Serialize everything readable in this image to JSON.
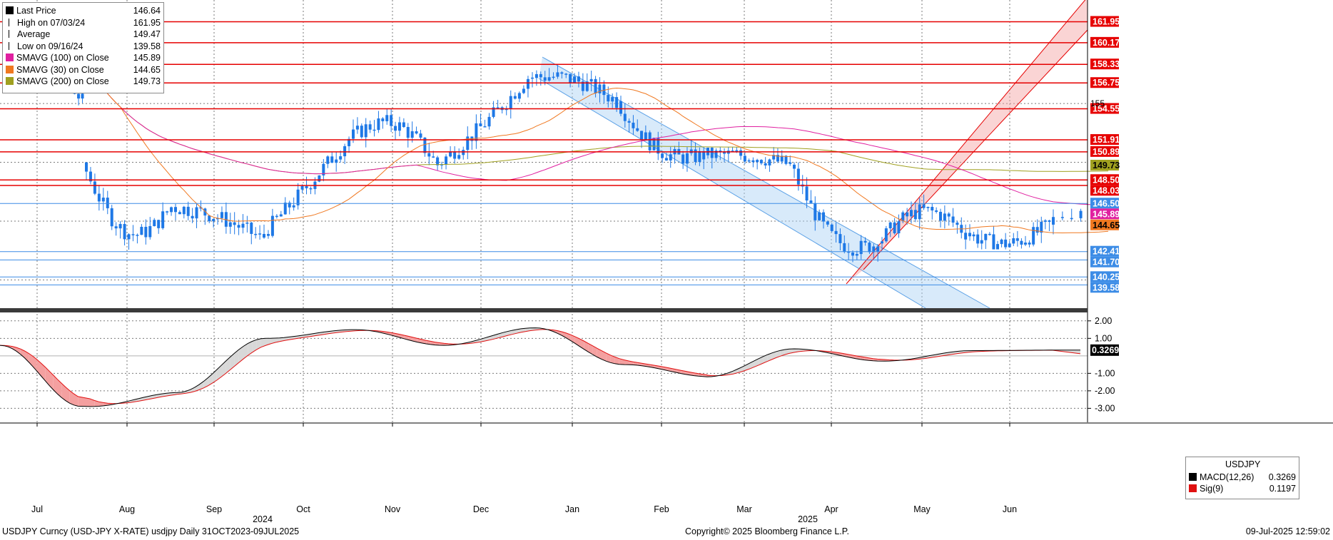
{
  "legend": {
    "rows": [
      {
        "label": "Last Price",
        "value": "146.64",
        "color": "#000000",
        "swatch": "square"
      },
      {
        "label": "High on 07/03/24",
        "value": "161.95",
        "color": "#000000",
        "swatch": "tick-high"
      },
      {
        "label": "Average",
        "value": "149.47",
        "color": "#000000",
        "swatch": "dash"
      },
      {
        "label": "Low on 09/16/24",
        "value": "139.58",
        "color": "#000000",
        "swatch": "tick-low"
      },
      {
        "label": "SMAVG (100)  on Close",
        "value": "145.89",
        "color": "#e020a0",
        "swatch": "square"
      },
      {
        "label": "SMAVG (30)  on Close",
        "value": "144.65",
        "color": "#f07820",
        "swatch": "square"
      },
      {
        "label": "SMAVG (200)  on Close",
        "value": "149.73",
        "color": "#a0a020",
        "swatch": "square"
      }
    ]
  },
  "macd_legend": {
    "title": "USDJPY",
    "rows": [
      {
        "label": "MACD(12,26)",
        "value": "0.3269",
        "color": "#000000"
      },
      {
        "label": "Sig(9)",
        "value": "0.1197",
        "color": "#e01010"
      }
    ]
  },
  "footer": {
    "left": "USDJPY Curncy (USD-JPY X-RATE) usdjpy  Daily 31OCT2023-09JUL2025",
    "center": "Copyright© 2025 Bloomberg Finance L.P.",
    "right": "09-Jul-2025 12:59:02"
  },
  "chart_data": [
    {
      "type": "candlestick",
      "title": "",
      "xlabel": "",
      "ylabel": "",
      "x_ticks": [
        "Jul",
        "Aug",
        "Sep",
        "Oct",
        "Nov",
        "Dec",
        "Jan",
        "Feb",
        "Mar",
        "Apr",
        "May",
        "Jun"
      ],
      "year_labels": [
        {
          "label": "2024",
          "month": "Sep-Oct"
        },
        {
          "label": "2025",
          "month": "Mar-Apr"
        }
      ],
      "y_range_visible": [
        137.6,
        163.8
      ],
      "y_axis_ticks": [
        "155"
      ],
      "monthly_ohlc_approx": [
        {
          "month": "Jul 2024",
          "open": 161.0,
          "high": 161.95,
          "low": 152.5,
          "close": 155.2
        },
        {
          "month": "Aug 2024",
          "open": 150.0,
          "high": 150.0,
          "low": 141.7,
          "close": 146.2
        },
        {
          "month": "Sep 2024",
          "open": 146.2,
          "high": 147.2,
          "low": 139.58,
          "close": 143.6
        },
        {
          "month": "Oct 2024",
          "open": 143.6,
          "high": 153.2,
          "low": 143.5,
          "close": 152.0
        },
        {
          "month": "Nov 2024",
          "open": 152.0,
          "high": 156.75,
          "low": 148.7,
          "close": 149.8
        },
        {
          "month": "Dec 2024",
          "open": 149.8,
          "high": 158.08,
          "low": 149.4,
          "close": 157.2
        },
        {
          "month": "Jan 2025",
          "open": 157.2,
          "high": 158.87,
          "low": 153.8,
          "close": 155.2
        },
        {
          "month": "Feb 2025",
          "open": 155.2,
          "high": 155.8,
          "low": 148.5,
          "close": 150.6
        },
        {
          "month": "Mar 2025",
          "open": 150.6,
          "high": 151.3,
          "low": 146.6,
          "close": 149.8
        },
        {
          "month": "Apr 2025",
          "open": 149.8,
          "high": 150.0,
          "low": 139.9,
          "close": 143.1
        },
        {
          "month": "May 2025",
          "open": 143.1,
          "high": 148.6,
          "low": 142.1,
          "close": 144.0
        },
        {
          "month": "Jun 2025",
          "open": 144.0,
          "high": 148.0,
          "low": 142.6,
          "close": 144.7
        },
        {
          "month": "Jul 2025",
          "open": 144.7,
          "high": 147.2,
          "low": 142.9,
          "close": 146.64
        }
      ],
      "price_levels": [
        {
          "label": "161.95",
          "value": 161.95,
          "color": "#e60000",
          "type": "horizontal-line"
        },
        {
          "label": "160.17",
          "value": 160.17,
          "color": "#e60000",
          "type": "horizontal-line"
        },
        {
          "label": "158.33",
          "value": 158.33,
          "color": "#e60000",
          "type": "horizontal-line"
        },
        {
          "label": "156.75",
          "value": 156.75,
          "color": "#e60000",
          "type": "horizontal-line"
        },
        {
          "label": "154.55",
          "value": 154.55,
          "color": "#e60000",
          "type": "horizontal-line"
        },
        {
          "label": "151.91",
          "value": 151.91,
          "color": "#e60000",
          "type": "horizontal-line"
        },
        {
          "label": "150.89",
          "value": 150.89,
          "color": "#e60000",
          "type": "horizontal-line"
        },
        {
          "label": "149.73",
          "value": 149.73,
          "color": "#a0a020",
          "type": "moving-average"
        },
        {
          "label": "148.50",
          "value": 148.5,
          "color": "#e60000",
          "type": "horizontal-line"
        },
        {
          "label": "148.03",
          "value": 148.03,
          "color": "#e60000",
          "type": "horizontal-line"
        },
        {
          "label": "146.50",
          "value": 146.5,
          "color": "#3c8ce6",
          "type": "horizontal-line"
        },
        {
          "label": "145.89",
          "value": 145.89,
          "color": "#e020a0",
          "type": "moving-average"
        },
        {
          "label": "144.65",
          "value": 144.65,
          "color": "#f07820",
          "type": "moving-average"
        },
        {
          "label": "142.41",
          "value": 142.41,
          "color": "#3c8ce6",
          "type": "horizontal-line"
        },
        {
          "label": "141.70",
          "value": 141.7,
          "color": "#3c8ce6",
          "type": "horizontal-line"
        },
        {
          "label": "140.25",
          "value": 140.25,
          "color": "#3c8ce6",
          "type": "horizontal-line"
        },
        {
          "label": "139.58",
          "value": 139.58,
          "color": "#3c8ce6",
          "type": "horizontal-line"
        }
      ],
      "channels": [
        {
          "name": "falling channel",
          "color": "#a8d0f4",
          "from": "mid-Dec 2024",
          "to": "late May 2025"
        },
        {
          "name": "rising channel",
          "color": "#f4a0a0",
          "from": "Apr 2025",
          "to": "Jul 2025"
        }
      ],
      "colors": {
        "candle": "#1e78e6",
        "sma100": "#e020a0",
        "sma30": "#f07820",
        "sma200": "#a0a020",
        "level_red": "#e60000",
        "level_blue": "#3c8ce6"
      }
    },
    {
      "type": "line",
      "title": "",
      "y_axis_ticks": [
        "2.00",
        "1.00",
        "-1.00",
        "-2.00",
        "-3.00"
      ],
      "ylim": [
        -3.8,
        2.4
      ],
      "current_value_label": "0.3269",
      "macd_monthly_approx": [
        {
          "month": "Jul 2024",
          "value": 0.6
        },
        {
          "month": "Aug 2024",
          "value": -2.9
        },
        {
          "month": "Sep 2024",
          "value": -2.1
        },
        {
          "month": "Oct 2024",
          "value": 1.0
        },
        {
          "month": "Nov 2024",
          "value": 1.5
        },
        {
          "month": "Dec 2024",
          "value": 0.6
        },
        {
          "month": "Jan 2025",
          "value": 1.6
        },
        {
          "month": "Feb 2025",
          "value": -0.5
        },
        {
          "month": "Mar 2025",
          "value": -1.2
        },
        {
          "month": "Apr 2025",
          "value": 0.4
        },
        {
          "month": "May 2025",
          "value": -0.3
        },
        {
          "month": "Jun 2025",
          "value": 0.3
        },
        {
          "month": "Jul 2025",
          "value": 0.3269
        }
      ],
      "signal_last": 0.1197,
      "colors": {
        "macd": "#000000",
        "signal": "#e01010",
        "fill_above": "#d8d8d8",
        "fill_below": "#f4a0a0"
      }
    }
  ]
}
